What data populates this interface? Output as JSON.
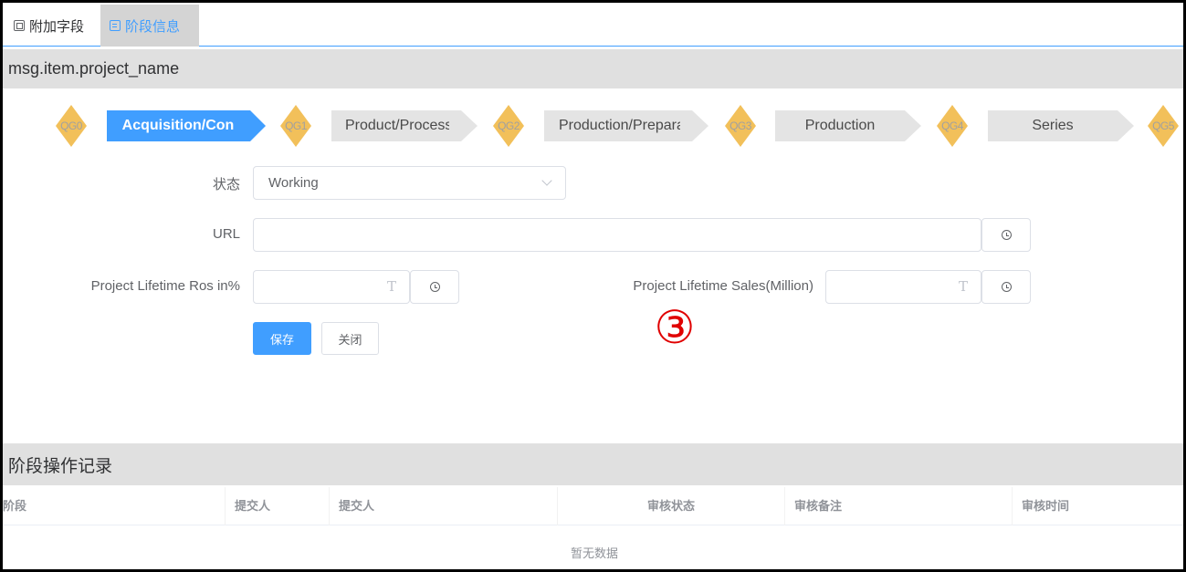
{
  "tabs": [
    {
      "label": "附加字段",
      "icon": "cpu-icon"
    },
    {
      "label": "阶段信息",
      "icon": "document-icon",
      "active": true
    }
  ],
  "section_title": "msg.item.project_name",
  "gates": [
    "QG0",
    "QG1",
    "QG2",
    "QG3",
    "QG4",
    "QG5"
  ],
  "steps": [
    {
      "label": "Acquisition/Con",
      "active": true
    },
    {
      "label": "Product/Process",
      "active": false
    },
    {
      "label": "Production/Prepara",
      "active": false
    },
    {
      "label": "Production",
      "active": false
    },
    {
      "label": "Series",
      "active": false
    }
  ],
  "form": {
    "status_label": "状态",
    "status_value": "Working",
    "url_label": "URL",
    "url_value": "",
    "ros_label": "Project Lifetime Ros in%",
    "ros_value": "",
    "sales_label": "Project Lifetime Sales(Million)",
    "sales_value": "",
    "save_label": "保存",
    "close_label": "关闭"
  },
  "annotation": "③",
  "log_title": "阶段操作记录",
  "table": {
    "columns": [
      "阶段",
      "提交人",
      "提交人",
      "审核状态",
      "审核备注",
      "审核时间"
    ],
    "empty_text": "暂无数据"
  },
  "colors": {
    "primary": "#409eff",
    "gate": "#f2c05a",
    "step_inactive": "#e4e4e4",
    "annotation": "#e00000"
  }
}
